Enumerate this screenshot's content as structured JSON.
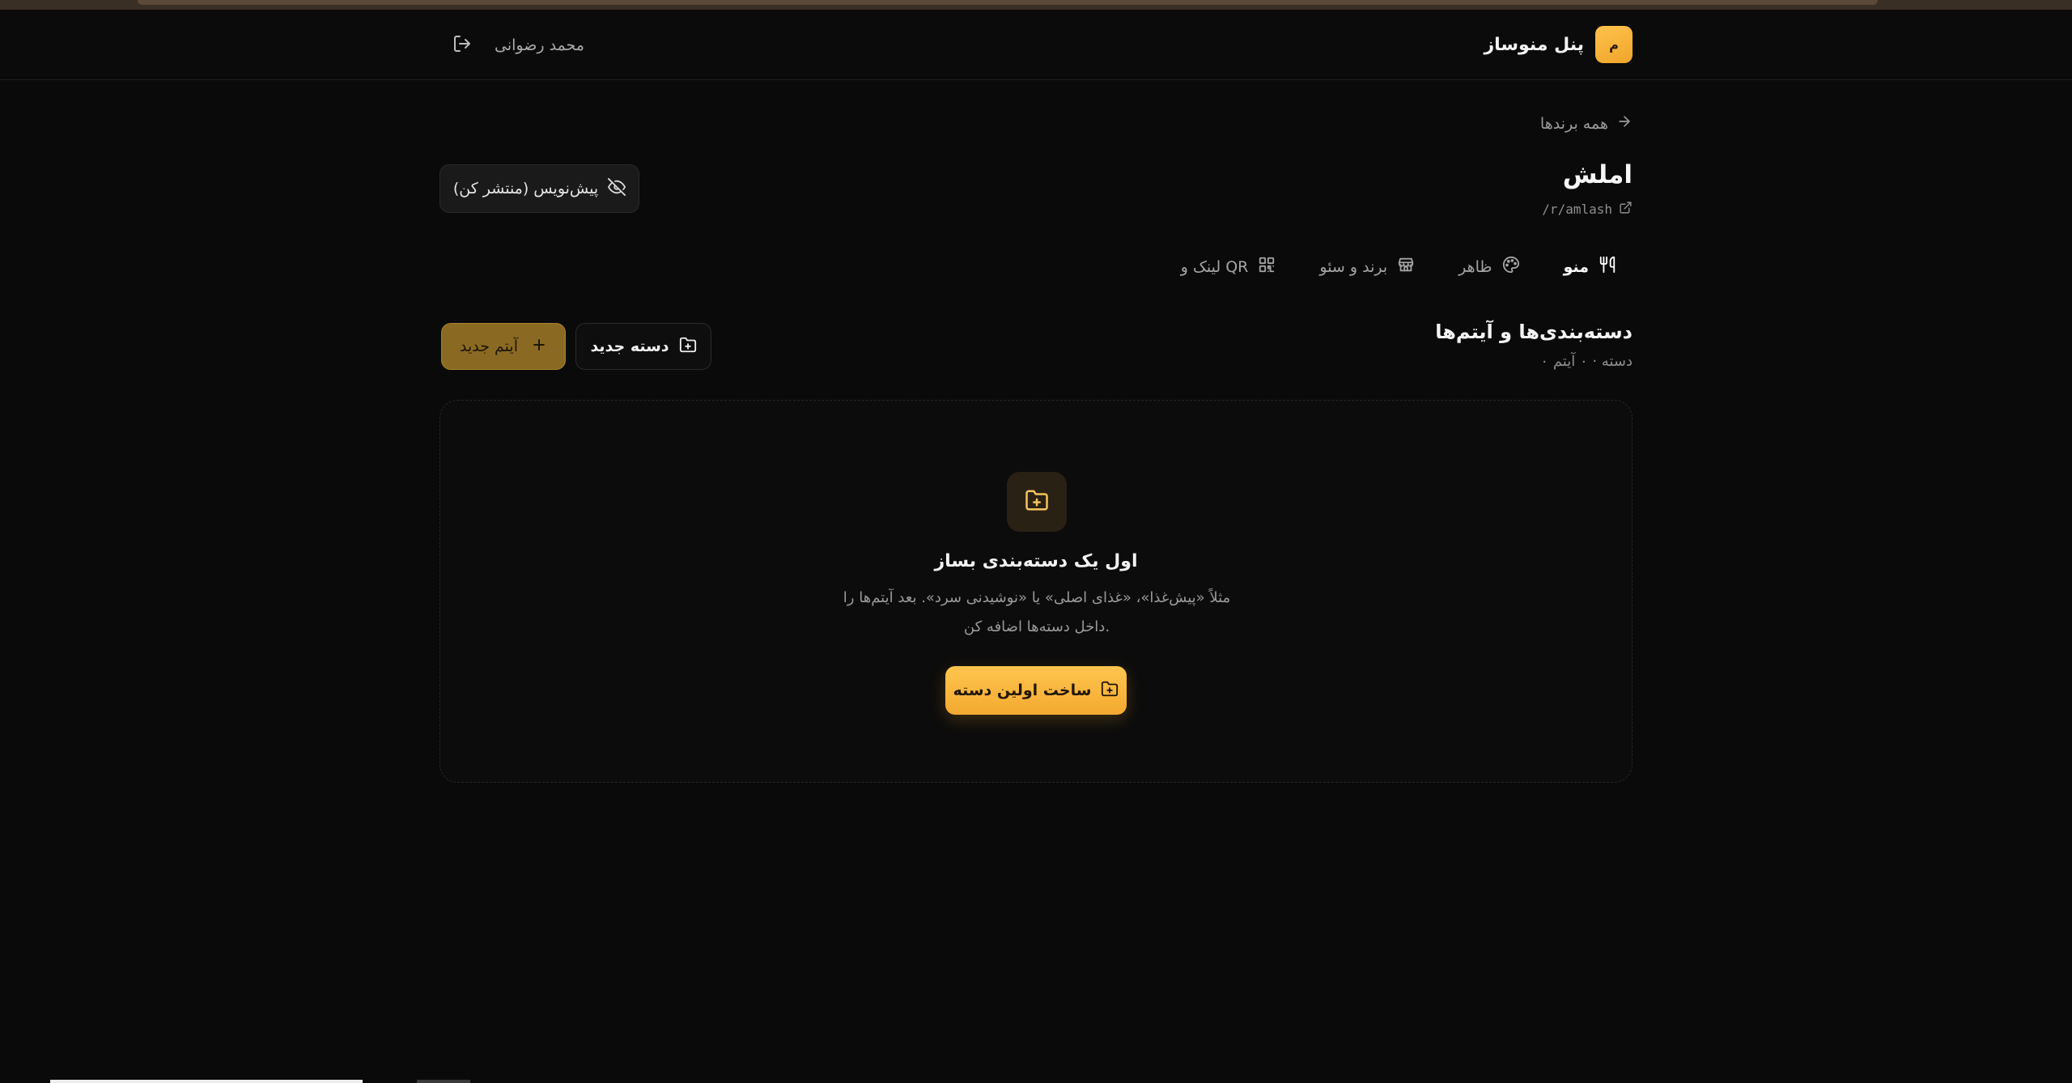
{
  "header": {
    "brand_initial": "م",
    "brand_title": "پنل منوساز",
    "user_name": "محمد رضوانی"
  },
  "page": {
    "back_label": "همه برندها",
    "brand_name": "املش",
    "slug": "/r/amlash",
    "status_label": "پیش‌نویس (منتشر کن)"
  },
  "tabs": [
    {
      "label": "منو",
      "icon": "utensils-icon",
      "active": true
    },
    {
      "label": "ظاهر",
      "icon": "palette-icon",
      "active": false
    },
    {
      "label": "برند و سئو",
      "icon": "store-icon",
      "active": false
    },
    {
      "label": "لینک و QR",
      "icon": "qr-code-icon",
      "active": false
    }
  ],
  "section": {
    "title": "دسته‌بندی‌ها و آیتم‌ها",
    "subtitle": "۰ دسته · ۰ آیتم",
    "new_category_label": "دسته جدید",
    "new_item_label": "آیتم جدید"
  },
  "empty_state": {
    "title": "اول یک دسته‌بندی بساز",
    "description_line1": "مثلاً «پیش‌غذا»، «غذای اصلی» یا «نوشیدنی سرد». بعد آیتم‌ها را",
    "description_line2": "داخل دسته‌ها اضافه کن.",
    "button_label": "ساخت اولین دسته"
  },
  "colors": {
    "accent": "#f5b23a",
    "background": "#0a0a0a"
  }
}
